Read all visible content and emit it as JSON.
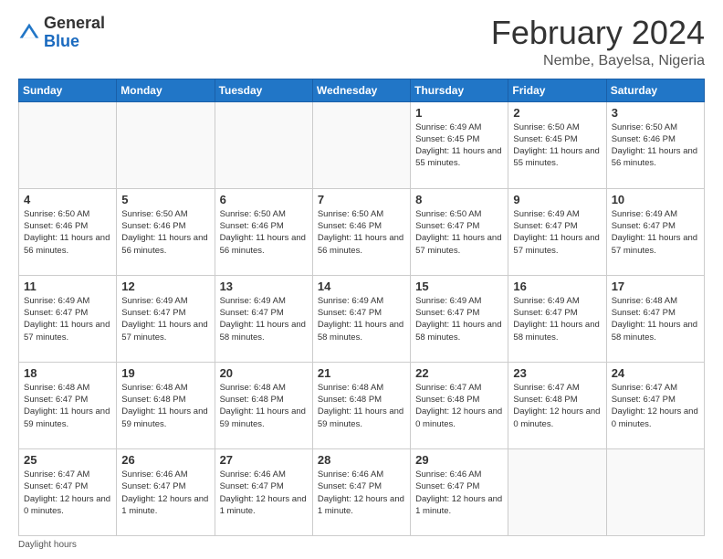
{
  "header": {
    "logo": {
      "general": "General",
      "blue": "Blue"
    },
    "title": "February 2024",
    "location": "Nembe, Bayelsa, Nigeria"
  },
  "calendar": {
    "days_of_week": [
      "Sunday",
      "Monday",
      "Tuesday",
      "Wednesday",
      "Thursday",
      "Friday",
      "Saturday"
    ],
    "weeks": [
      [
        {
          "day": "",
          "info": ""
        },
        {
          "day": "",
          "info": ""
        },
        {
          "day": "",
          "info": ""
        },
        {
          "day": "",
          "info": ""
        },
        {
          "day": "1",
          "info": "Sunrise: 6:49 AM\nSunset: 6:45 PM\nDaylight: 11 hours and 55 minutes."
        },
        {
          "day": "2",
          "info": "Sunrise: 6:50 AM\nSunset: 6:45 PM\nDaylight: 11 hours and 55 minutes."
        },
        {
          "day": "3",
          "info": "Sunrise: 6:50 AM\nSunset: 6:46 PM\nDaylight: 11 hours and 56 minutes."
        }
      ],
      [
        {
          "day": "4",
          "info": "Sunrise: 6:50 AM\nSunset: 6:46 PM\nDaylight: 11 hours and 56 minutes."
        },
        {
          "day": "5",
          "info": "Sunrise: 6:50 AM\nSunset: 6:46 PM\nDaylight: 11 hours and 56 minutes."
        },
        {
          "day": "6",
          "info": "Sunrise: 6:50 AM\nSunset: 6:46 PM\nDaylight: 11 hours and 56 minutes."
        },
        {
          "day": "7",
          "info": "Sunrise: 6:50 AM\nSunset: 6:46 PM\nDaylight: 11 hours and 56 minutes."
        },
        {
          "day": "8",
          "info": "Sunrise: 6:50 AM\nSunset: 6:47 PM\nDaylight: 11 hours and 57 minutes."
        },
        {
          "day": "9",
          "info": "Sunrise: 6:49 AM\nSunset: 6:47 PM\nDaylight: 11 hours and 57 minutes."
        },
        {
          "day": "10",
          "info": "Sunrise: 6:49 AM\nSunset: 6:47 PM\nDaylight: 11 hours and 57 minutes."
        }
      ],
      [
        {
          "day": "11",
          "info": "Sunrise: 6:49 AM\nSunset: 6:47 PM\nDaylight: 11 hours and 57 minutes."
        },
        {
          "day": "12",
          "info": "Sunrise: 6:49 AM\nSunset: 6:47 PM\nDaylight: 11 hours and 57 minutes."
        },
        {
          "day": "13",
          "info": "Sunrise: 6:49 AM\nSunset: 6:47 PM\nDaylight: 11 hours and 58 minutes."
        },
        {
          "day": "14",
          "info": "Sunrise: 6:49 AM\nSunset: 6:47 PM\nDaylight: 11 hours and 58 minutes."
        },
        {
          "day": "15",
          "info": "Sunrise: 6:49 AM\nSunset: 6:47 PM\nDaylight: 11 hours and 58 minutes."
        },
        {
          "day": "16",
          "info": "Sunrise: 6:49 AM\nSunset: 6:47 PM\nDaylight: 11 hours and 58 minutes."
        },
        {
          "day": "17",
          "info": "Sunrise: 6:48 AM\nSunset: 6:47 PM\nDaylight: 11 hours and 58 minutes."
        }
      ],
      [
        {
          "day": "18",
          "info": "Sunrise: 6:48 AM\nSunset: 6:47 PM\nDaylight: 11 hours and 59 minutes."
        },
        {
          "day": "19",
          "info": "Sunrise: 6:48 AM\nSunset: 6:48 PM\nDaylight: 11 hours and 59 minutes."
        },
        {
          "day": "20",
          "info": "Sunrise: 6:48 AM\nSunset: 6:48 PM\nDaylight: 11 hours and 59 minutes."
        },
        {
          "day": "21",
          "info": "Sunrise: 6:48 AM\nSunset: 6:48 PM\nDaylight: 11 hours and 59 minutes."
        },
        {
          "day": "22",
          "info": "Sunrise: 6:47 AM\nSunset: 6:48 PM\nDaylight: 12 hours and 0 minutes."
        },
        {
          "day": "23",
          "info": "Sunrise: 6:47 AM\nSunset: 6:48 PM\nDaylight: 12 hours and 0 minutes."
        },
        {
          "day": "24",
          "info": "Sunrise: 6:47 AM\nSunset: 6:47 PM\nDaylight: 12 hours and 0 minutes."
        }
      ],
      [
        {
          "day": "25",
          "info": "Sunrise: 6:47 AM\nSunset: 6:47 PM\nDaylight: 12 hours and 0 minutes."
        },
        {
          "day": "26",
          "info": "Sunrise: 6:46 AM\nSunset: 6:47 PM\nDaylight: 12 hours and 1 minute."
        },
        {
          "day": "27",
          "info": "Sunrise: 6:46 AM\nSunset: 6:47 PM\nDaylight: 12 hours and 1 minute."
        },
        {
          "day": "28",
          "info": "Sunrise: 6:46 AM\nSunset: 6:47 PM\nDaylight: 12 hours and 1 minute."
        },
        {
          "day": "29",
          "info": "Sunrise: 6:46 AM\nSunset: 6:47 PM\nDaylight: 12 hours and 1 minute."
        },
        {
          "day": "",
          "info": ""
        },
        {
          "day": "",
          "info": ""
        }
      ]
    ]
  },
  "footer": {
    "note": "Daylight hours"
  }
}
